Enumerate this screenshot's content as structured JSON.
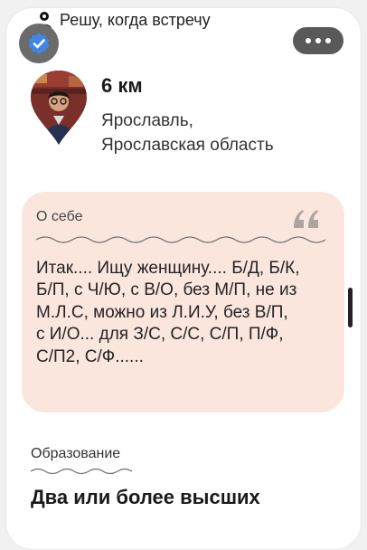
{
  "header": {
    "hint_text": "Решу, когда встречу",
    "hint_icon": "person-icon"
  },
  "profile": {
    "verified_icon": "check-badge-icon",
    "more_icon": "more-dots-icon",
    "distance": "6 км",
    "location_line1": "Ярославль,",
    "location_line2": "Ярославская область"
  },
  "about": {
    "title": "О себе",
    "quote_icon": "quote-icon",
    "lines": [
      "Итак.... Ищу женщину.... Б/Д, Б/К,",
      "Б/П, с Ч/Ю, с В/О, без М/П, не из",
      "М.Л.С, можно из Л.И.У, без В/П,",
      "с И/О... для З/С, С/С, С/П, П/Ф,",
      "С/П2, С/Ф......"
    ]
  },
  "education": {
    "title": "Образование",
    "value": "Два или более высших"
  },
  "colors": {
    "about_bg": "#fbe6de",
    "badge_bg": "#6b6b6b",
    "accent_blue": "#3f86e6",
    "more_bg": "#595959"
  }
}
